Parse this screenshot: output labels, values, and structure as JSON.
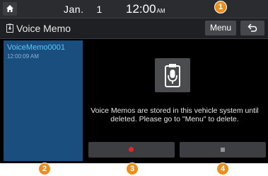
{
  "status": {
    "month": "Jan.",
    "day": "1",
    "time": "12:00",
    "ampm": "AM"
  },
  "header": {
    "title": "Voice Memo",
    "menu_label": "Menu"
  },
  "memos": [
    {
      "name": "VoiceMemo0001",
      "time": "12:00:09 AM"
    }
  ],
  "message": "Voice Memos are stored in this vehicle system until deleted. Please go to \"Menu\" to delete.",
  "callouts": [
    "1",
    "2",
    "3",
    "4"
  ],
  "colors": {
    "accent": "#5fc6f7",
    "list_bg": "#1a4e7e",
    "record": "#e5252a",
    "callout": "#e8901a"
  }
}
